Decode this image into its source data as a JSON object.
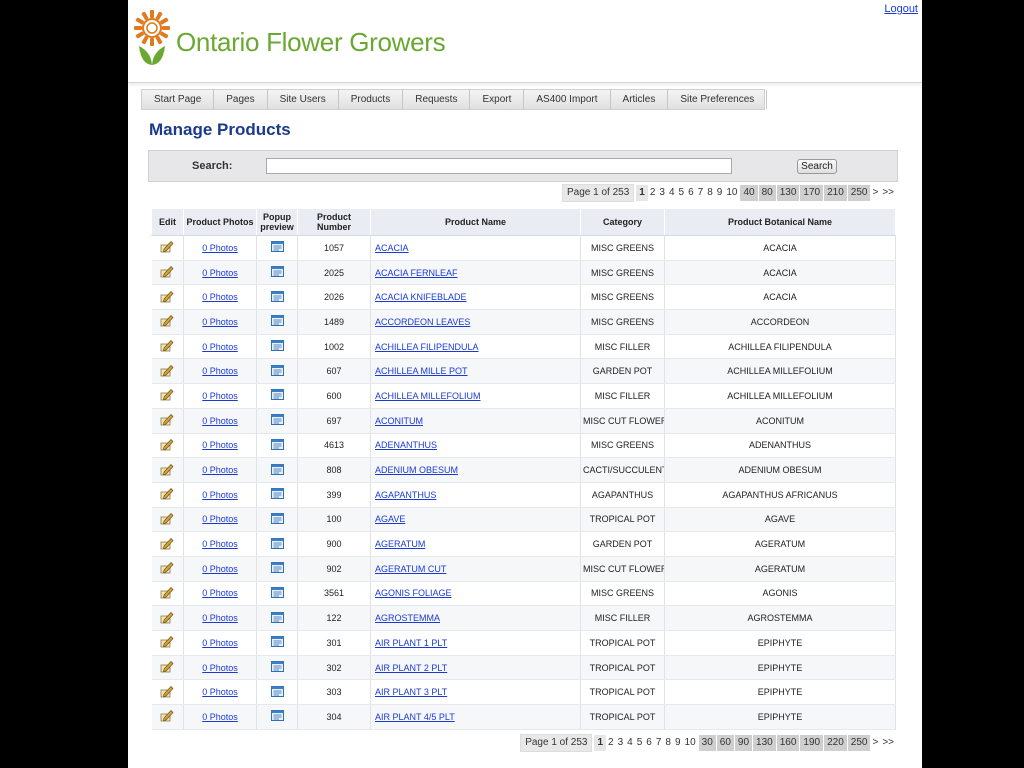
{
  "brand": {
    "name": "Ontario Flower Growers"
  },
  "header": {
    "logout_label": "Logout"
  },
  "nav": [
    "Start Page",
    "Pages",
    "Site Users",
    "Products",
    "Requests",
    "Export",
    "AS400 Import",
    "Articles",
    "Site Preferences"
  ],
  "page_title": "Manage Products",
  "search": {
    "label": "Search:",
    "value": "",
    "placeholder": "",
    "button_label": "Search"
  },
  "pager_top": {
    "info": "Page 1 of 253",
    "pages": [
      "1",
      "2",
      "3",
      "4",
      "5",
      "6",
      "7",
      "8",
      "9",
      "10",
      "40",
      "80",
      "130",
      "170",
      "210",
      "250",
      ">",
      ">>"
    ]
  },
  "pager_bottom": {
    "info": "Page 1 of 253",
    "pages": [
      "1",
      "2",
      "3",
      "4",
      "5",
      "6",
      "7",
      "8",
      "9",
      "10",
      "30",
      "60",
      "90",
      "130",
      "160",
      "190",
      "220",
      "250",
      ">",
      ">>"
    ]
  },
  "table": {
    "headers": {
      "edit": "Edit",
      "photos": "Product Photos",
      "popup_line1": "Popup",
      "popup_line2": "preview",
      "number_line1": "Product",
      "number_line2": "Number",
      "name": "Product Name",
      "category": "Category",
      "botanical": "Product Botanical Name"
    },
    "rows": [
      {
        "photos": "0 Photos",
        "number": "1057",
        "name": "ACACIA",
        "category": "MISC GREENS",
        "botanical": "ACACIA"
      },
      {
        "photos": "0 Photos",
        "number": "2025",
        "name": "ACACIA FERNLEAF",
        "category": "MISC GREENS",
        "botanical": "ACACIA"
      },
      {
        "photos": "0 Photos",
        "number": "2026",
        "name": "ACACIA KNIFEBLADE",
        "category": "MISC GREENS",
        "botanical": "ACACIA"
      },
      {
        "photos": "0 Photos",
        "number": "1489",
        "name": "ACCORDEON LEAVES",
        "category": "MISC GREENS",
        "botanical": "ACCORDEON"
      },
      {
        "photos": "0 Photos",
        "number": "1002",
        "name": "ACHILLEA FILIPENDULA",
        "category": "MISC FILLER",
        "botanical": "ACHILLEA FILIPENDULA"
      },
      {
        "photos": "0 Photos",
        "number": "607",
        "name": "ACHILLEA MILLE POT",
        "category": "GARDEN POT",
        "botanical": "ACHILLEA MILLEFOLIUM"
      },
      {
        "photos": "0 Photos",
        "number": "600",
        "name": "ACHILLEA MILLEFOLIUM",
        "category": "MISC FILLER",
        "botanical": "ACHILLEA MILLEFOLIUM"
      },
      {
        "photos": "0 Photos",
        "number": "697",
        "name": "ACONITUM",
        "category": "MISC CUT FLOWER",
        "botanical": "ACONITUM"
      },
      {
        "photos": "0 Photos",
        "number": "4613",
        "name": "ADENANTHUS",
        "category": "MISC GREENS",
        "botanical": "ADENANTHUS"
      },
      {
        "photos": "0 Photos",
        "number": "808",
        "name": "ADENIUM OBESUM",
        "category": "CACTI/SUCCULENT",
        "botanical": "ADENIUM OBESUM"
      },
      {
        "photos": "0 Photos",
        "number": "399",
        "name": "AGAPANTHUS",
        "category": "AGAPANTHUS",
        "botanical": "AGAPANTHUS AFRICANUS"
      },
      {
        "photos": "0 Photos",
        "number": "100",
        "name": "AGAVE",
        "category": "TROPICAL POT",
        "botanical": "AGAVE"
      },
      {
        "photos": "0 Photos",
        "number": "900",
        "name": "AGERATUM",
        "category": "GARDEN POT",
        "botanical": "AGERATUM"
      },
      {
        "photos": "0 Photos",
        "number": "902",
        "name": "AGERATUM CUT",
        "category": "MISC CUT FLOWER",
        "botanical": "AGERATUM"
      },
      {
        "photos": "0 Photos",
        "number": "3561",
        "name": "AGONIS FOLIAGE",
        "category": "MISC GREENS",
        "botanical": "AGONIS"
      },
      {
        "photos": "0 Photos",
        "number": "122",
        "name": "AGROSTEMMA",
        "category": "MISC FILLER",
        "botanical": "AGROSTEMMA"
      },
      {
        "photos": "0 Photos",
        "number": "301",
        "name": "AIR PLANT 1 PLT",
        "category": "TROPICAL POT",
        "botanical": "EPIPHYTE"
      },
      {
        "photos": "0 Photos",
        "number": "302",
        "name": "AIR PLANT 2 PLT",
        "category": "TROPICAL POT",
        "botanical": "EPIPHYTE"
      },
      {
        "photos": "0 Photos",
        "number": "303",
        "name": "AIR PLANT 3 PLT",
        "category": "TROPICAL POT",
        "botanical": "EPIPHYTE"
      },
      {
        "photos": "0 Photos",
        "number": "304",
        "name": "AIR PLANT 4/5 PLT",
        "category": "TROPICAL POT",
        "botanical": "EPIPHYTE"
      }
    ]
  },
  "colors": {
    "brand_green": "#6aa832",
    "brand_orange": "#e07a1f",
    "title_blue": "#1b3a8c",
    "link_blue": "#1a3ad6"
  },
  "icons": {
    "edit": "edit-pencil-icon",
    "popup": "popup-preview-icon",
    "logo": "sunflower-logo-icon"
  }
}
